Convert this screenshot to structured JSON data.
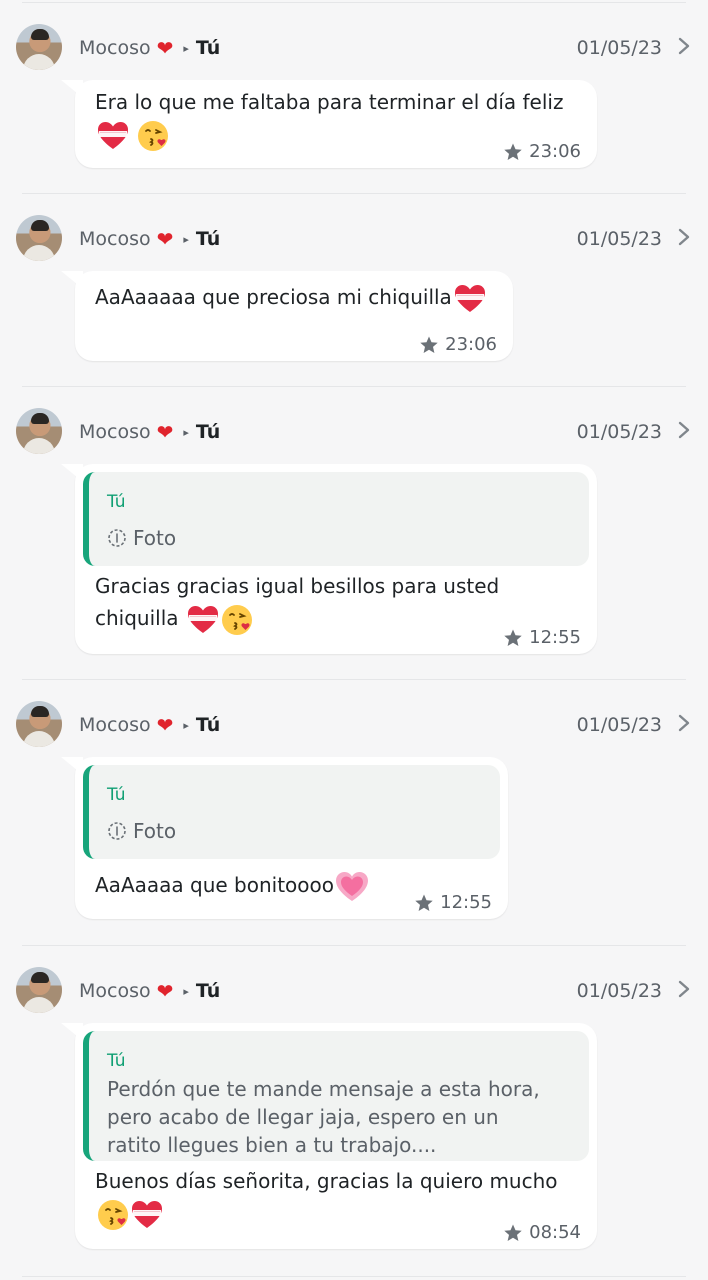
{
  "colors": {
    "background": "#f6f6f7",
    "bubble": "#ffffff",
    "quote_bar": "#18a57b",
    "quote_author": "#0f9f73",
    "muted": "#5b6168",
    "heart": "#e0242d"
  },
  "entries": [
    {
      "sender": "Mocoso",
      "recipient": "Tú",
      "date": "01/05/23",
      "text_line1": "Era lo que me faltaba para terminar el día feliz",
      "text_line2": "",
      "time": "23:06",
      "emojis": [
        "heart-ribbon",
        "kiss-face"
      ]
    },
    {
      "sender": "Mocoso",
      "recipient": "Tú",
      "date": "01/05/23",
      "text_line1": "AaAaaaaa que preciosa mi chiquilla",
      "time": "23:06",
      "emojis": [
        "heart-ribbon"
      ]
    },
    {
      "sender": "Mocoso",
      "recipient": "Tú",
      "date": "01/05/23",
      "quote_author": "Tú",
      "quote_text": "Foto",
      "text_line1": "Gracias gracias igual besillos para usted",
      "text_line2": "chiquilla",
      "time": "12:55",
      "emojis": [
        "heart-ribbon",
        "kiss-face"
      ]
    },
    {
      "sender": "Mocoso",
      "recipient": "Tú",
      "date": "01/05/23",
      "quote_author": "Tú",
      "quote_text": "Foto",
      "text_line1": "AaAaaaa que bonitoooo",
      "time": "12:55",
      "emojis": [
        "growing-heart"
      ]
    },
    {
      "sender": "Mocoso",
      "recipient": "Tú",
      "date": "01/05/23",
      "quote_author": "Tú",
      "quote_line1": "Perdón que te mande mensaje a esta hora,",
      "quote_line2": "pero acabo de llegar jaja, espero en un",
      "quote_line3": "ratito llegues bien a tu trabajo....",
      "text_line1": "Buenos días señorita, gracias la quiero mucho",
      "time": "08:54",
      "emojis": [
        "kiss-face",
        "heart-ribbon"
      ]
    }
  ]
}
